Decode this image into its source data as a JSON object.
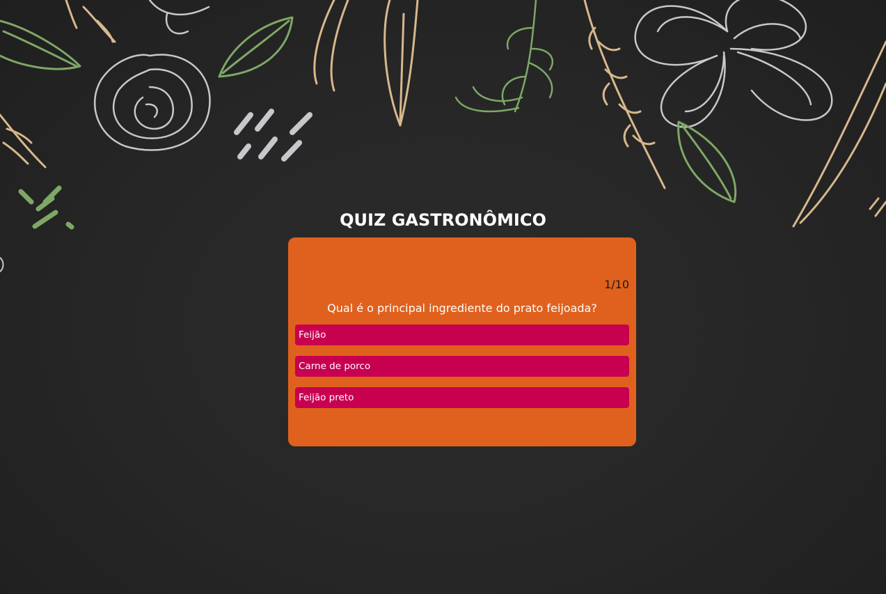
{
  "quiz": {
    "title": "QUIZ GASTRONÔMICO",
    "counter": "1/10",
    "question": "Qual é o principal ingrediente do prato feijoada?",
    "answers": [
      {
        "label": "Feijão"
      },
      {
        "label": "Carne de porco"
      },
      {
        "label": "Feijão preto"
      }
    ]
  },
  "colors": {
    "background": "#262626",
    "card": "#e0611e",
    "answer": "#c80050",
    "doodle_green": "#7fa866",
    "doodle_beige": "#d8b88c",
    "doodle_gray": "#c8c8cc"
  },
  "background_art": {
    "description_icons": [
      "leaf-doodle-icon",
      "spiral-rose-doodle-icon",
      "flower-doodle-icon",
      "herb-sprig-doodle-icon"
    ]
  }
}
